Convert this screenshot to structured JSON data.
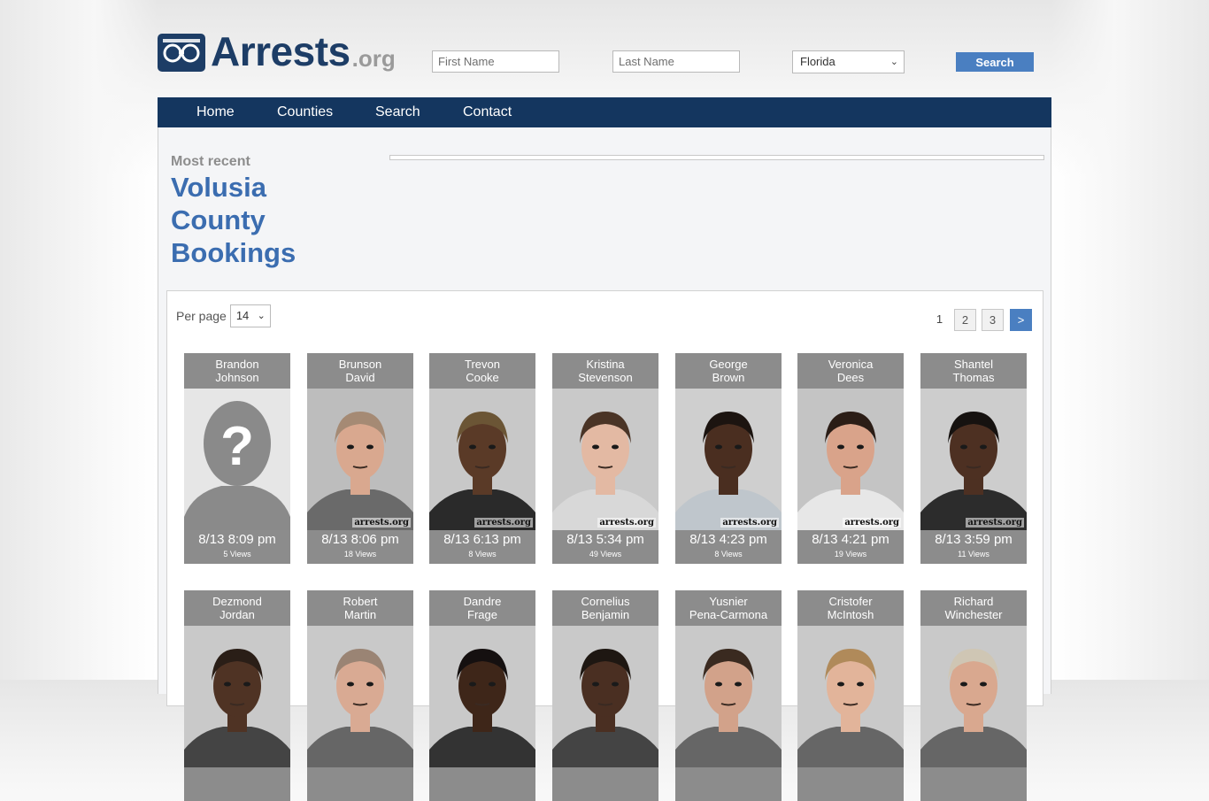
{
  "header": {
    "logo_main": "Arrests",
    "logo_tld": ".org",
    "first_name_placeholder": "First Name",
    "last_name_placeholder": "Last Name",
    "state_selected": "Florida",
    "search_label": "Search"
  },
  "nav": [
    "Home",
    "Counties",
    "Search",
    "Contact"
  ],
  "main": {
    "most_recent": "Most recent",
    "title_line1": "Volusia",
    "title_line2": "County",
    "title_line3": "Bookings"
  },
  "listing": {
    "per_page_label": "Per page",
    "per_page_value": "14",
    "pages": [
      "1",
      "2",
      "3"
    ],
    "next_label": ">",
    "watermark": "arrests.org"
  },
  "bookings": [
    {
      "first": "Brandon",
      "last": "Johnson",
      "time": "8/13 8:09 pm",
      "views": "5 Views",
      "placeholder": true,
      "skin": "#8a8a8a",
      "hair": "#8a8a8a"
    },
    {
      "first": "Brunson",
      "last": "David",
      "time": "8/13 8:06 pm",
      "views": "18 Views",
      "skin": "#d9a88f",
      "hair": "#a58a74",
      "bg": "#bdbdbd",
      "shirt": "#6a6a6a"
    },
    {
      "first": "Trevon",
      "last": "Cooke",
      "time": "8/13 6:13 pm",
      "views": "8 Views",
      "skin": "#5a3a27",
      "hair": "#6b5535",
      "bg": "#c8c8c8",
      "shirt": "#2a2a2a"
    },
    {
      "first": "Kristina",
      "last": "Stevenson",
      "time": "8/13 5:34 pm",
      "views": "49 Views",
      "skin": "#e3b9a3",
      "hair": "#4a3426",
      "bg": "#c9c9c9",
      "shirt": "#d8d8d8"
    },
    {
      "first": "George",
      "last": "Brown",
      "time": "8/13 4:23 pm",
      "views": "8 Views",
      "skin": "#4a2e20",
      "hair": "#1c1410",
      "bg": "#cfcfcf",
      "shirt": "#bfc6cc"
    },
    {
      "first": "Veronica",
      "last": "Dees",
      "time": "8/13 4:21 pm",
      "views": "19 Views",
      "skin": "#d9a38a",
      "hair": "#2b1d16",
      "bg": "#c4c4c4",
      "shirt": "#e7e7e7"
    },
    {
      "first": "Shantel",
      "last": "Thomas",
      "time": "8/13 3:59 pm",
      "views": "11 Views",
      "skin": "#4d3022",
      "hair": "#161210",
      "bg": "#cdcdcd",
      "shirt": "#2c2c2c"
    },
    {
      "first": "Dezmond",
      "last": "Jordan",
      "time": "",
      "views": "",
      "skin": "#4f3324",
      "hair": "#2a1e17",
      "bg": "#c9c9c9",
      "shirt": "#444"
    },
    {
      "first": "Robert",
      "last": "Martin",
      "time": "",
      "views": "",
      "skin": "#d9aa93",
      "hair": "#9a8474",
      "bg": "#c9c9c9",
      "shirt": "#666"
    },
    {
      "first": "Dandre",
      "last": "Frage",
      "time": "",
      "views": "",
      "skin": "#3e2619",
      "hair": "#151010",
      "bg": "#c9c9c9",
      "shirt": "#333"
    },
    {
      "first": "Cornelius",
      "last": "Benjamin",
      "time": "",
      "views": "",
      "skin": "#4a2f22",
      "hair": "#1e1712",
      "bg": "#c9c9c9",
      "shirt": "#444"
    },
    {
      "first": "Yusnier",
      "last": "Pena-Carmona",
      "time": "",
      "views": "",
      "skin": "#d2a28a",
      "hair": "#3a2a20",
      "bg": "#c9c9c9",
      "shirt": "#666"
    },
    {
      "first": "Cristofer",
      "last": "McIntosh",
      "time": "",
      "views": "",
      "skin": "#e2b49a",
      "hair": "#b08a5a",
      "bg": "#c9c9c9",
      "shirt": "#666"
    },
    {
      "first": "Richard",
      "last": "Winchester",
      "time": "",
      "views": "",
      "skin": "#d9a88f",
      "hair": "#cfc6b4",
      "bg": "#c9c9c9",
      "shirt": "#666"
    }
  ],
  "colors": {
    "brand": "#1d3d66",
    "accent": "#4a7fc1",
    "nav": "#14365f",
    "title": "#3b6db0"
  }
}
